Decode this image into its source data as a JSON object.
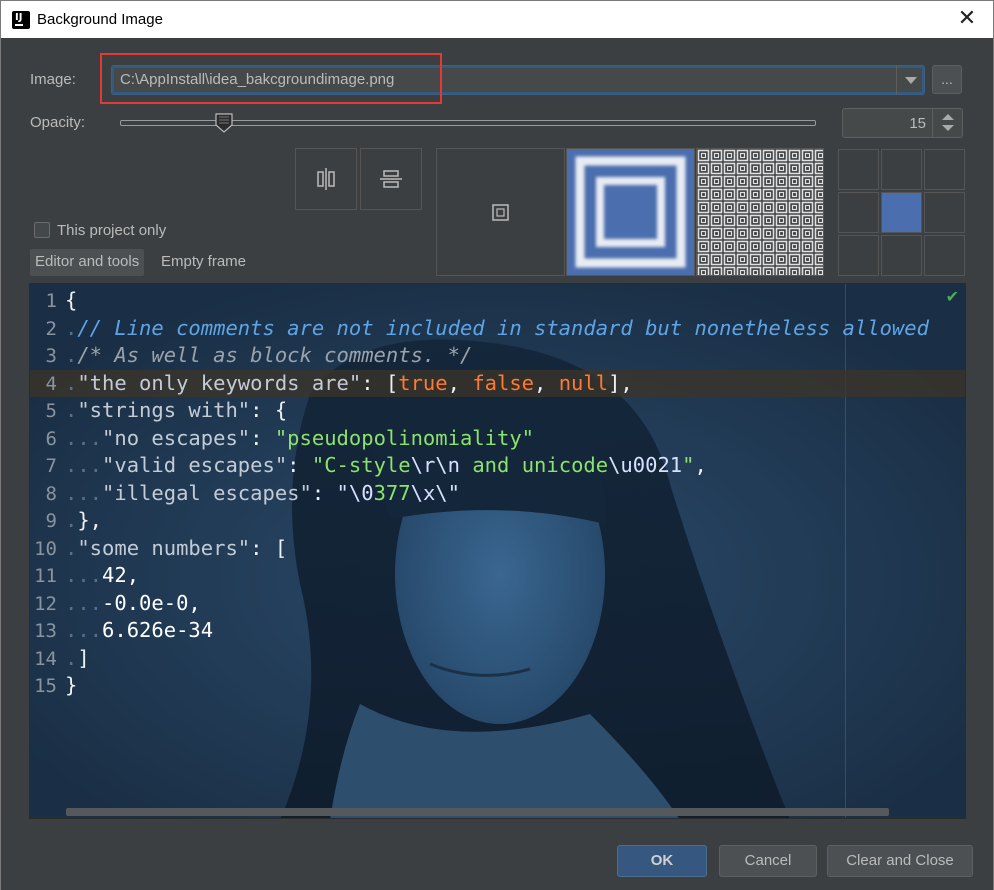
{
  "window": {
    "title": "Background Image",
    "close_glyph": "✕"
  },
  "image": {
    "label": "Image:",
    "path": "C:\\AppInstall\\idea_bakcgroundimage.png",
    "browse_label": "..."
  },
  "opacity": {
    "label": "Opacity:",
    "value": "15",
    "slider_fraction": 0.15
  },
  "options": {
    "this_project_only": "This project only",
    "this_project_only_checked": false
  },
  "tabs": [
    {
      "label": "Editor and tools",
      "active": true
    },
    {
      "label": "Empty frame",
      "active": false
    }
  ],
  "fill_modes": [
    "center",
    "scale",
    "tile"
  ],
  "selected_fill_mode": "scale",
  "anchor_selected": "center",
  "editor": {
    "lines": [
      {
        "n": "1"
      },
      {
        "n": "2"
      },
      {
        "n": "3"
      },
      {
        "n": "4"
      },
      {
        "n": "5"
      },
      {
        "n": "6"
      },
      {
        "n": "7"
      },
      {
        "n": "8"
      },
      {
        "n": "9"
      },
      {
        "n": "10"
      },
      {
        "n": "11"
      },
      {
        "n": "12"
      },
      {
        "n": "13"
      },
      {
        "n": "14"
      },
      {
        "n": "15"
      }
    ],
    "code": {
      "l1": "{",
      "l2": "// Line comments are not included in standard but nonetheless allowed",
      "l3": "/* As well as block comments. */",
      "l4_key": "\"the only keywords are\"",
      "l4_true": "true",
      "l4_false": "false",
      "l4_null": "null",
      "l5_key": "\"strings with\"",
      "l6_key": "\"no escapes\"",
      "l6_val": "\"pseudopolinomiality\"",
      "l7_key": "\"valid escapes\"",
      "l7_a": "\"C-style",
      "l7_b": "\\r\\n",
      "l7_c": " and unicode",
      "l7_d": "\\u0021",
      "l7_e": "\"",
      "l8_key": "\"illegal escapes\"",
      "l8_a": "\"\\0",
      "l8_b": "377",
      "l8_c": "\\x\\\"",
      "l10_key": "\"some numbers\"",
      "l11": "42,",
      "l12": "-0.0e-0,",
      "l13": "6.626e-34"
    },
    "check_glyph": "✔"
  },
  "buttons": {
    "ok": "OK",
    "cancel": "Cancel",
    "clear_close": "Clear and Close"
  }
}
